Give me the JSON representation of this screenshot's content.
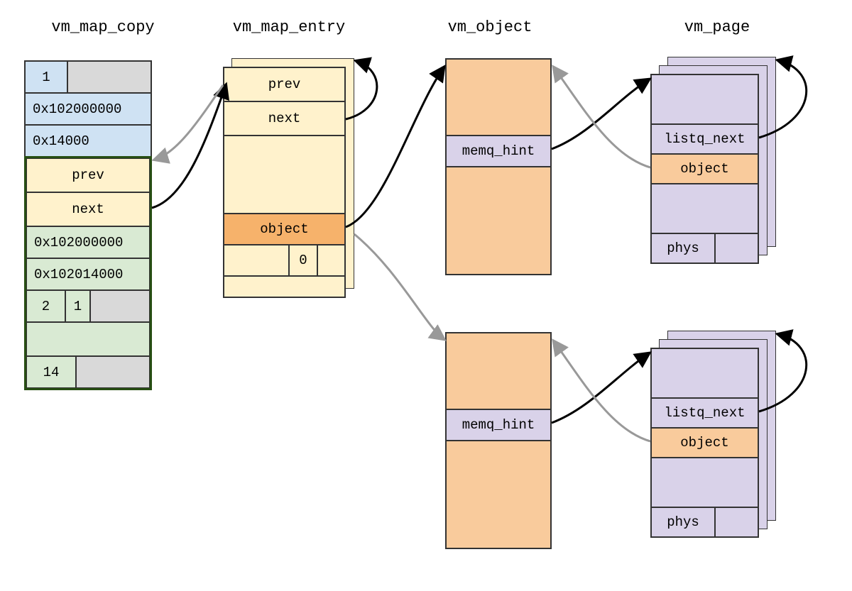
{
  "headings": {
    "col1": "vm_map_copy",
    "col2": "vm_map_entry",
    "col3": "vm_object",
    "col4": "vm_page"
  },
  "vm_map_copy": {
    "header_val": "1",
    "addr1": "0x102000000",
    "addr2": "0x14000",
    "prev": "prev",
    "next": "next",
    "addr3": "0x102000000",
    "addr4": "0x102014000",
    "counter1": "2",
    "counter2": "1",
    "counter3": "14"
  },
  "vm_map_entry": {
    "prev": "prev",
    "next": "next",
    "object": "object",
    "bottom_val": "0"
  },
  "vm_object": {
    "memq_hint": "memq_hint"
  },
  "vm_page": {
    "listq_next": "listq_next",
    "object": "object",
    "phys": "phys"
  },
  "colors": {
    "blue": "#cfe2f3",
    "gray": "#d9d9d9",
    "yellow": "#fff2cc",
    "green": "#d9ead3",
    "purple": "#d9d2e9",
    "orange_light": "#f9cb9c",
    "orange_field": "#f6b26b",
    "outline_green": "#274e13",
    "arrow_black": "#000000",
    "arrow_gray": "#999999"
  }
}
